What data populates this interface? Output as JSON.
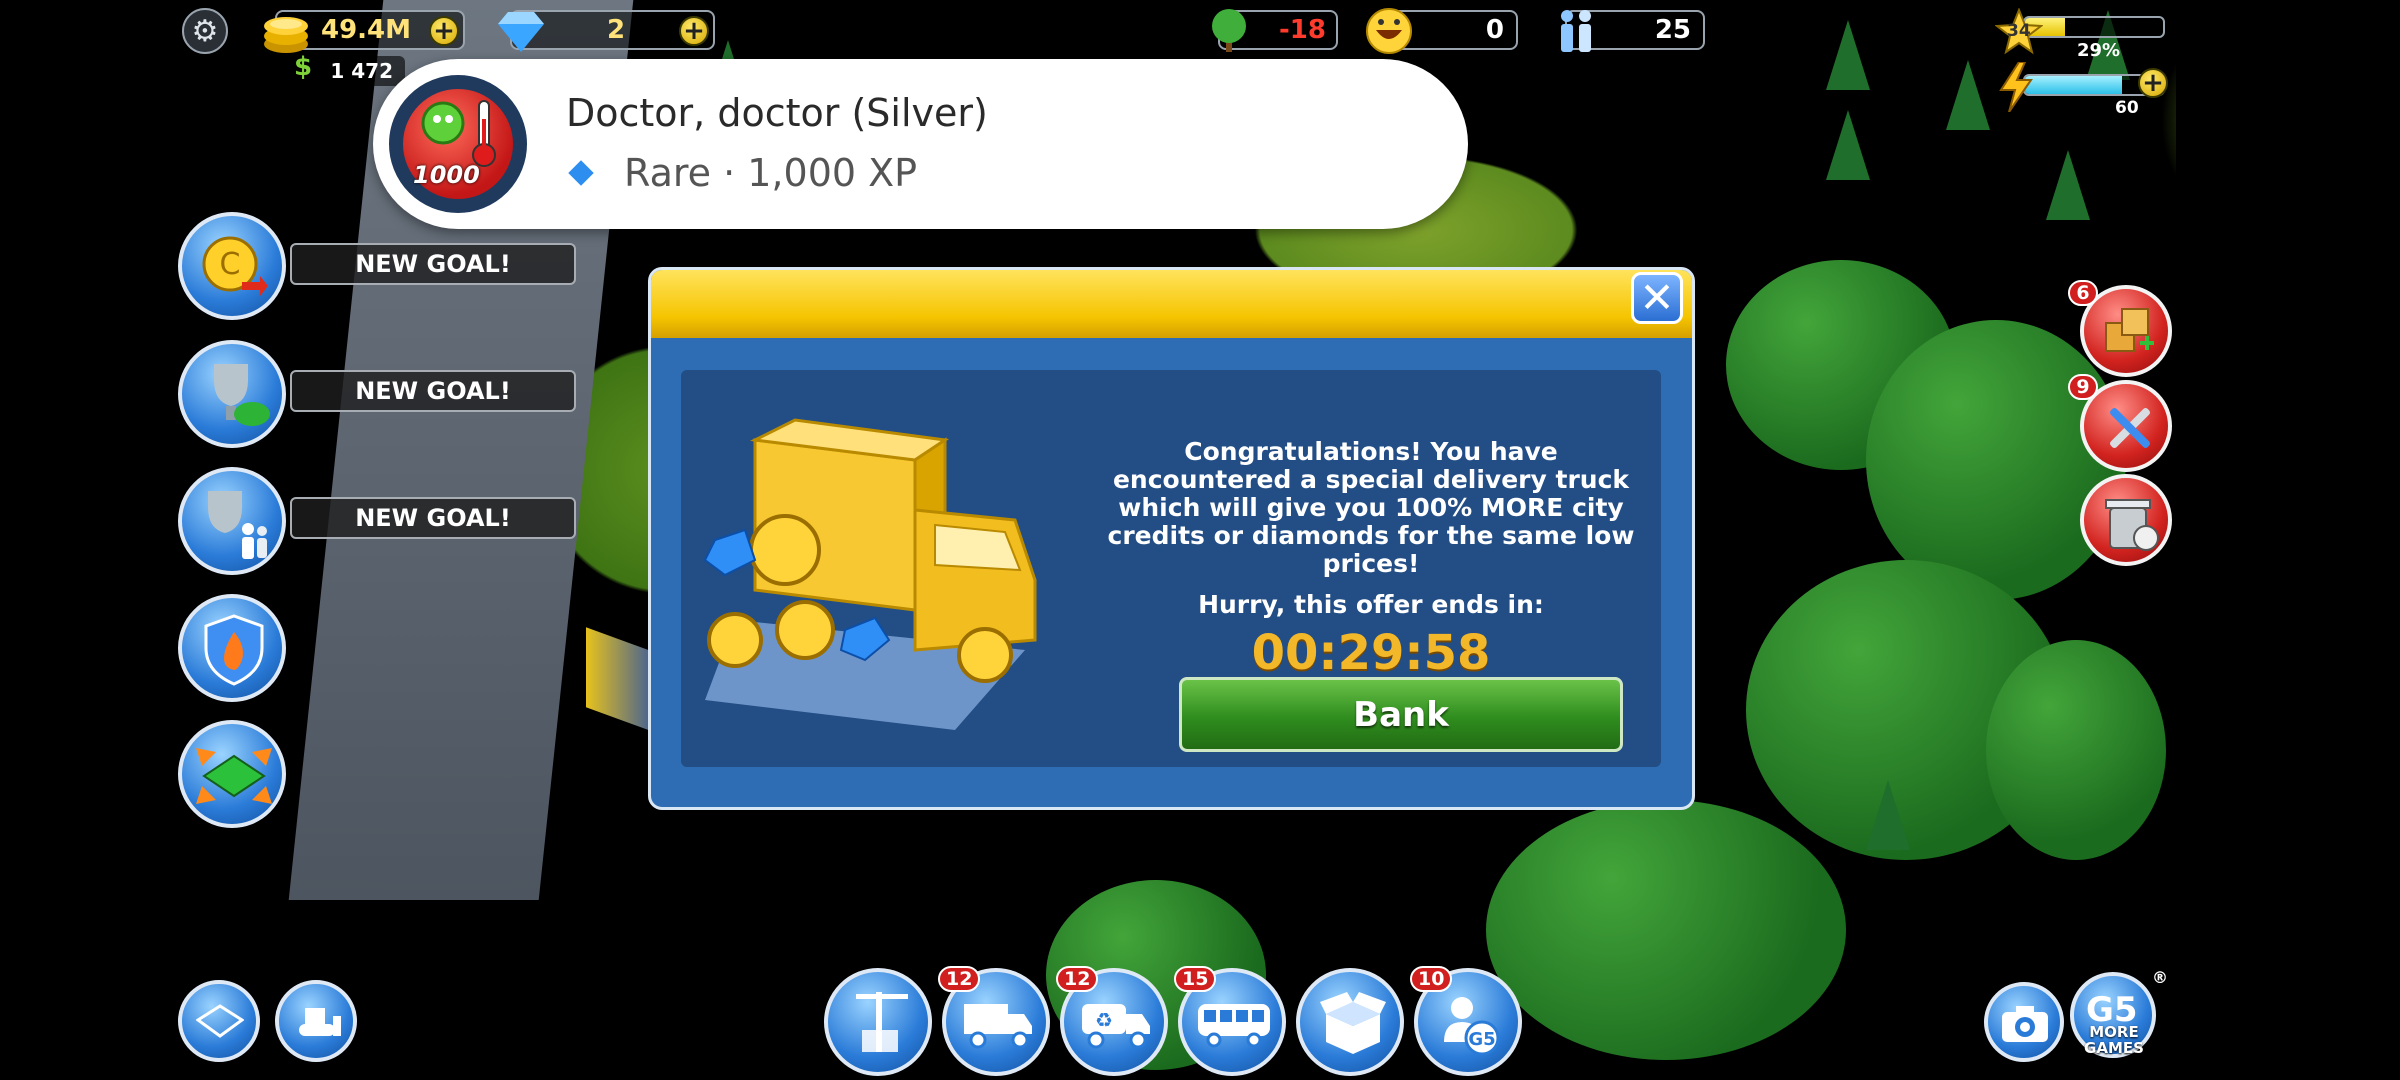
{
  "hud": {
    "coins": "49.4M",
    "diamonds": "2",
    "sub_coins": "1 472",
    "ecology": "-18",
    "happiness": "0",
    "population": "25",
    "level": "34",
    "level_percent_label": "29%",
    "level_percent": 29,
    "energy": "60",
    "energy_percent": 70
  },
  "toast": {
    "title": "Doctor, doctor (Silver)",
    "subtitle": "Rare · 1,000 XP",
    "badge_number": "1000"
  },
  "goals": {
    "label": "NEW GOAL!"
  },
  "dialog": {
    "message": "Congratulations! You have encountered a special delivery truck which will give you 100% MORE city credits or diamonds for the same low prices!",
    "hurry_text": "Hurry, this offer ends in:",
    "timer": "00:29:58",
    "button": "Bank",
    "close": "✕"
  },
  "right_buttons": {
    "materials_badge": "6",
    "tools_badge": "9"
  },
  "bottom_bar": {
    "truck_badge": "12",
    "recycle_badge": "12",
    "bus_badge": "15",
    "friends_badge": "10",
    "more_games": "MORE GAMES",
    "brand": "G5"
  },
  "colors": {
    "gold": "#f5c400",
    "dialog_blue": "#2e6db3",
    "panel_blue": "#224d85",
    "button_green": "#2f8d1e",
    "timer_gold": "#f3b72a"
  }
}
